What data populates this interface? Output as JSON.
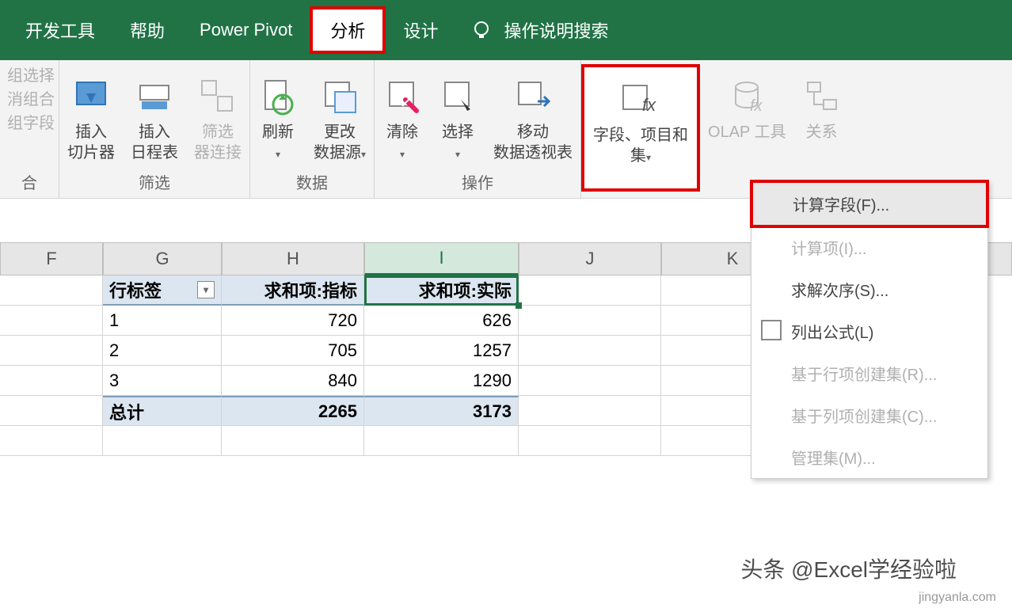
{
  "menubar": {
    "dev_tools": "开发工具",
    "help": "帮助",
    "power_pivot": "Power Pivot",
    "analyze": "分析",
    "design": "设计",
    "search_placeholder": "操作说明搜索"
  },
  "ribbon": {
    "left": {
      "group_select": "组选择",
      "ungroup": "消组合",
      "group_field": "组字段",
      "group_label": "合"
    },
    "filter": {
      "slicer": "插入\n切片器",
      "timeline": "插入\n日程表",
      "filter_conn": "筛选\n器连接",
      "label": "筛选"
    },
    "data": {
      "refresh": "刷新",
      "change_source": "更改\n数据源",
      "label": "数据"
    },
    "actions": {
      "clear": "清除",
      "select": "选择",
      "move_pivot": "移动\n数据透视表",
      "label": "操作"
    },
    "calc": {
      "fields_sets": "字段、项目和\n集",
      "olap": "OLAP 工具",
      "relations": "关系"
    }
  },
  "dropdown": {
    "calc_field": "计算字段(F)...",
    "calc_item": "计算项(I)...",
    "solve_order": "求解次序(S)...",
    "list_formulas": "列出公式(L)",
    "row_set": "基于行项创建集(R)...",
    "col_set": "基于列项创建集(C)...",
    "manage_sets": "管理集(M)..."
  },
  "columns": {
    "F": "F",
    "G": "G",
    "H": "H",
    "I": "I",
    "J": "J",
    "K": "K"
  },
  "pivot": {
    "row_labels": "行标签",
    "sum_target": "求和项:指标",
    "sum_actual": "求和项:实际",
    "rows": [
      {
        "label": "1",
        "target": "720",
        "actual": "626"
      },
      {
        "label": "2",
        "target": "705",
        "actual": "1257"
      },
      {
        "label": "3",
        "target": "840",
        "actual": "1290"
      }
    ],
    "total_label": "总计",
    "total_target": "2265",
    "total_actual": "3173"
  },
  "chart_data": {
    "type": "table",
    "title": "Pivot Table",
    "columns": [
      "行标签",
      "求和项:指标",
      "求和项:实际"
    ],
    "rows": [
      [
        "1",
        720,
        626
      ],
      [
        "2",
        705,
        1257
      ],
      [
        "3",
        840,
        1290
      ]
    ],
    "totals": [
      "总计",
      2265,
      3173
    ]
  },
  "watermark": {
    "text": "头条 @Excel学经验啦",
    "url": "jingyanla.com"
  }
}
